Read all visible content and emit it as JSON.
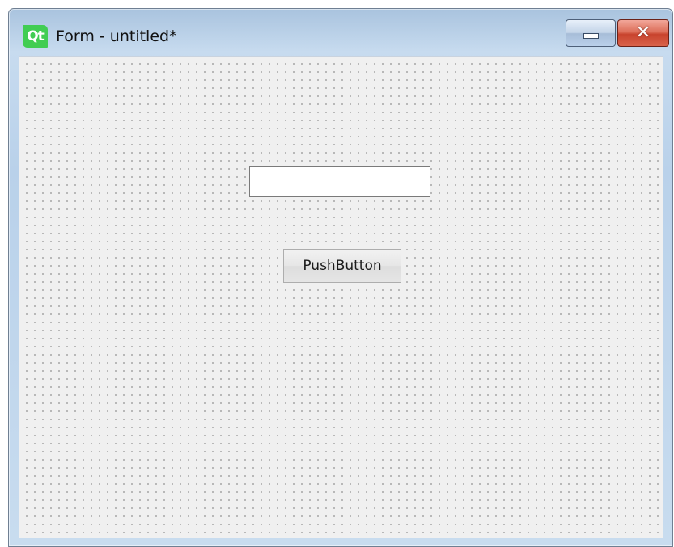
{
  "window": {
    "title": "Form - untitled*",
    "app_logo_text": "Qt",
    "controls": {
      "minimize_icon": "minimize-icon",
      "close_icon": "close-icon",
      "close_glyph": "✕"
    }
  },
  "form": {
    "line_edit": {
      "value": "",
      "placeholder": ""
    },
    "push_button_label": "PushButton"
  },
  "colors": {
    "qt_green": "#41cd52",
    "title_frame": "#b9d1ea",
    "close_red": "#c8432d",
    "form_background": "#f0f0f0"
  }
}
